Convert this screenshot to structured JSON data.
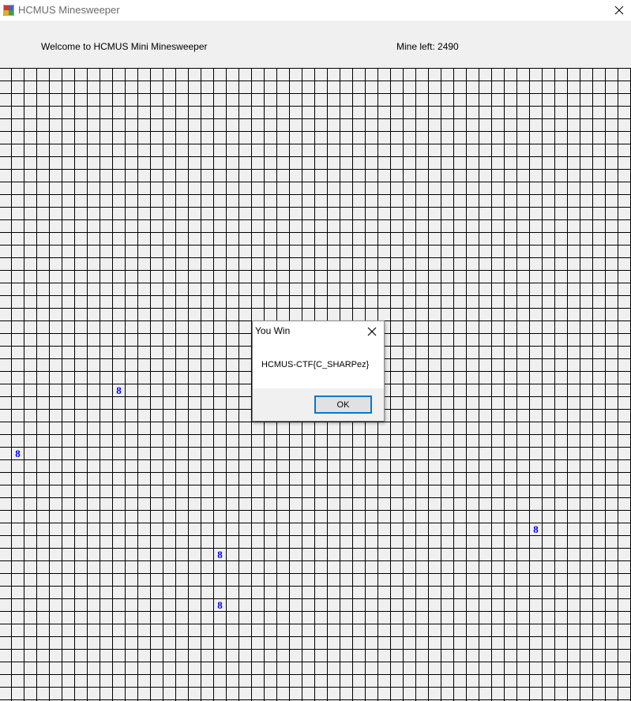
{
  "window": {
    "title": "HCMUS Minesweeper"
  },
  "header": {
    "welcome": "Welcome to HCMUS Mini Minesweeper",
    "mine_left": "Mine left: 2490"
  },
  "board": {
    "revealed_cells": [
      {
        "label": "8",
        "row": 25,
        "col": 9
      },
      {
        "label": "8",
        "row": 30,
        "col": 1
      },
      {
        "label": "8",
        "row": 36,
        "col": 42
      },
      {
        "label": "8",
        "row": 38,
        "col": 17
      },
      {
        "label": "8",
        "row": 42,
        "col": 17
      }
    ],
    "number_color": "#0000ff",
    "line_color": "#000000",
    "background": "#f0f0f0"
  },
  "dialog": {
    "title": "You Win",
    "message": "HCMUS-CTF{C_SHARPez}",
    "ok_label": "OK",
    "accent": "#0078d7"
  },
  "icons": {
    "app": "app-icon",
    "close": "close-icon"
  }
}
